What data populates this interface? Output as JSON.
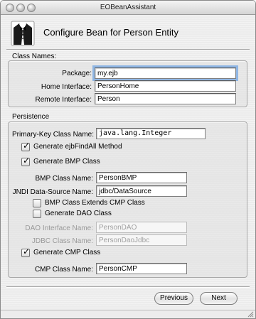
{
  "window": {
    "title": "EOBeanAssistant"
  },
  "header": {
    "title": "Configure Bean for Person Entity"
  },
  "class_names": {
    "group_label": "Class Names:",
    "package": {
      "label": "Package:",
      "value": "my.ejb"
    },
    "home_interface": {
      "label": "Home Interface:",
      "value": "PersonHome"
    },
    "remote_interface": {
      "label": "Remote Interface:",
      "value": "Person"
    }
  },
  "persistence": {
    "group_label": "Persistence",
    "primary_key": {
      "label": "Primary-Key Class Name:",
      "value": "java.lang.Integer"
    },
    "generate_findall": {
      "label": "Generate ejbFindAll Method",
      "checked": true
    },
    "generate_bmp": {
      "label": "Generate BMP Class",
      "checked": true
    },
    "bmp_class_name": {
      "label": "BMP Class Name:",
      "value": "PersonBMP"
    },
    "jndi_data_source": {
      "label": "JNDI Data-Source Name:",
      "value": "jdbc/DataSource"
    },
    "bmp_extends_cmp": {
      "label": "BMP Class Extends CMP Class",
      "checked": false
    },
    "generate_dao": {
      "label": "Generate DAO Class",
      "checked": false
    },
    "dao_interface_name": {
      "label": "DAO Interface Name:",
      "value": "PersonDAO"
    },
    "jdbc_class_name": {
      "label": "JDBC Class Name:",
      "value": "PersonDaoJdbc"
    },
    "generate_cmp": {
      "label": "Generate CMP Class",
      "checked": true
    },
    "cmp_class_name": {
      "label": "CMP Class Name:",
      "value": "PersonCMP"
    }
  },
  "buttons": {
    "previous": "Previous",
    "next": "Next"
  },
  "icons": {
    "app": "tuxedo-bean-icon"
  }
}
